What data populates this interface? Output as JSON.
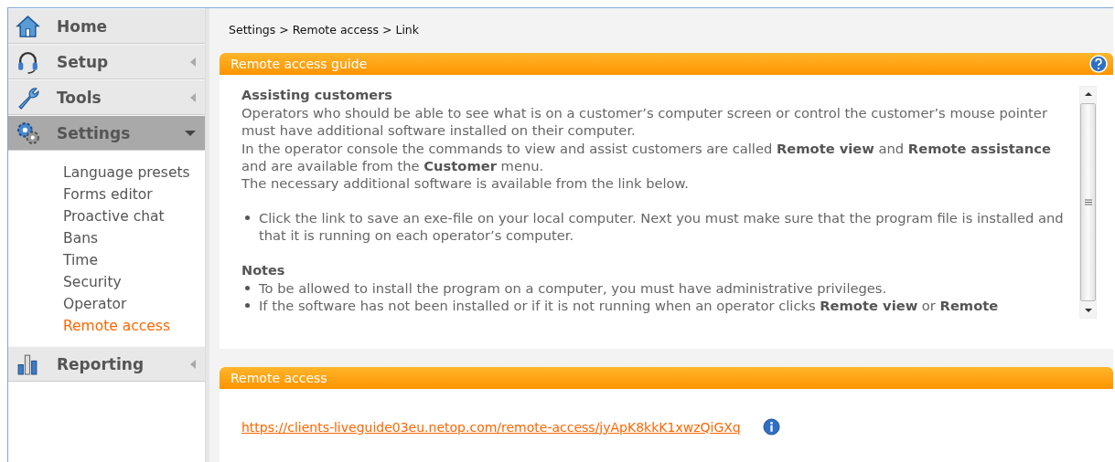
{
  "nav": [
    {
      "label": "Home",
      "selected": false
    },
    {
      "label": "Setup",
      "selected": false,
      "expanded": false
    },
    {
      "label": "Tools",
      "selected": false,
      "expanded": false
    },
    {
      "label": "Settings",
      "selected": true,
      "expanded": true,
      "children": [
        {
          "label": "Language presets",
          "selected": false
        },
        {
          "label": "Forms editor",
          "selected": false
        },
        {
          "label": "Proactive chat",
          "selected": false
        },
        {
          "label": "Bans",
          "selected": false
        },
        {
          "label": "Time",
          "selected": false
        },
        {
          "label": "Security",
          "selected": false
        },
        {
          "label": "Operator",
          "selected": false
        },
        {
          "label": "Remote access",
          "selected": true
        }
      ]
    },
    {
      "label": "Reporting",
      "selected": false,
      "expanded": false
    }
  ],
  "breadcrumb": "Settings > Remote access > Link",
  "guide": {
    "title": "Remote access guide",
    "heading": "Assisting customers",
    "paragraphs": [
      "Operators who should be able to see what is on a customer’s computer screen or control the customer’s mouse pointer must have additional software installed on their computer.",
      "In the operator console the commands to view and assist customers are called **Remote view** and **Remote assistance** and are available from the **Customer** menu.",
      "The necessary additional software is available from the link below."
    ],
    "steps": [
      "Click the link to save an exe-file on your local computer. Next you must make sure that the program file is installed and that it is running on each operator’s computer."
    ],
    "notes_heading": "Notes",
    "notes": [
      "To be allowed to install the program on a computer, you must have administrative privileges.",
      "If the software has not been installed or if it is not running when an operator clicks **Remote view** or **Remote**"
    ]
  },
  "remote": {
    "title": "Remote access",
    "link": "https://clients-liveguide03eu.netop.com/remote-access/jyApK8kkK1xwzQiGXq"
  }
}
